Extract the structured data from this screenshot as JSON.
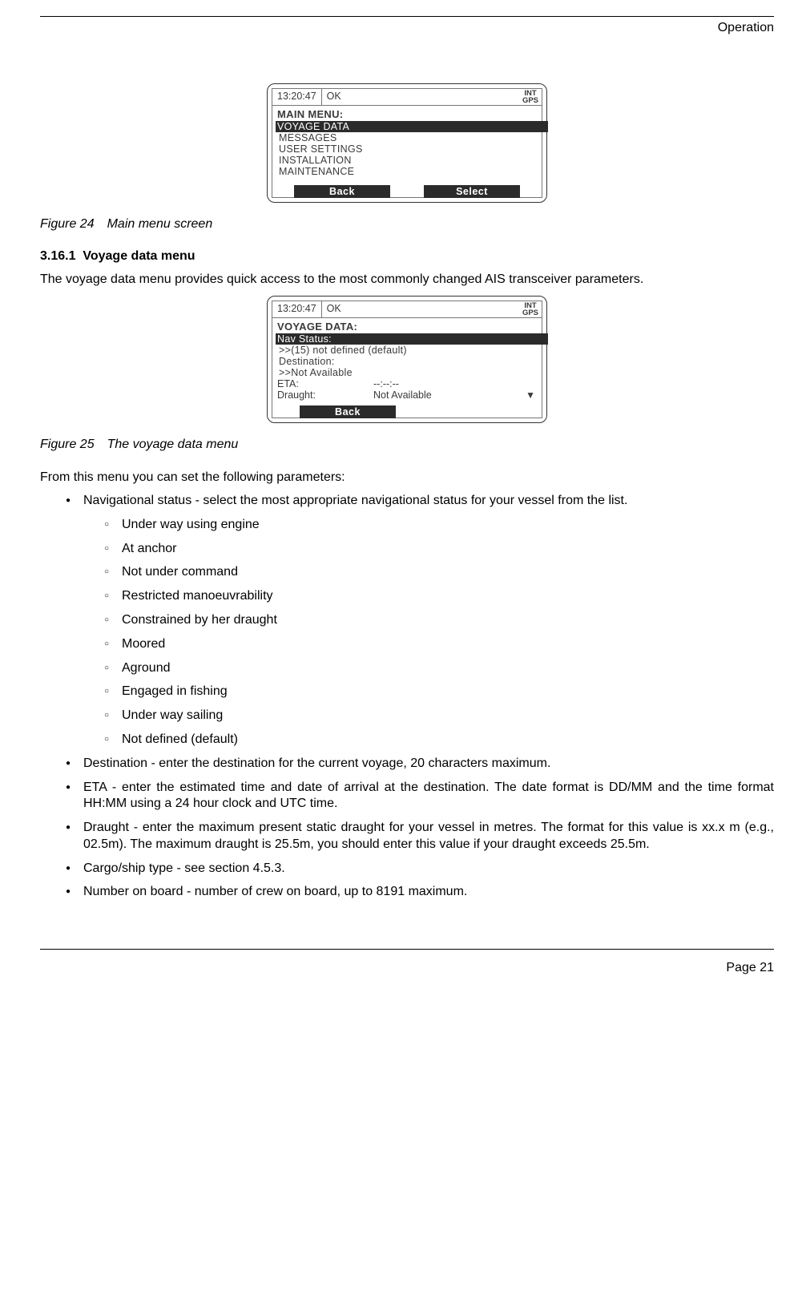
{
  "header": {
    "section": "Operation"
  },
  "screen1": {
    "time": "13:20:47",
    "status": "OK",
    "gps_l1": "INT",
    "gps_l2": "GPS",
    "title": "MAIN MENU:",
    "items": [
      "VOYAGE DATA",
      "MESSAGES",
      "USER SETTINGS",
      "INSTALLATION",
      "MAINTENANCE"
    ],
    "btn_back": "Back",
    "btn_select": "Select"
  },
  "fig24": {
    "num": "Figure 24",
    "caption": "Main menu screen"
  },
  "sec": {
    "num": "3.16.1",
    "title": "Voyage data menu"
  },
  "p1": "The voyage data menu provides quick access to the most commonly changed AIS transceiver parameters.",
  "screen2": {
    "time": "13:20:47",
    "status": "OK",
    "gps_l1": "INT",
    "gps_l2": "GPS",
    "title": "VOYAGE DATA:",
    "nav_label": "Nav Status:",
    "nav_value": ">>(15) not defined (default)",
    "dest_label": "Destination:",
    "dest_value": ">>Not Available",
    "eta_label": "ETA:",
    "eta_value": "--:--:--",
    "drt_label": "Draught:",
    "drt_value": "Not Available",
    "btn_back": "Back"
  },
  "fig25": {
    "num": "Figure 25",
    "caption": "The voyage data menu"
  },
  "p2": "From this menu you can set the following parameters:",
  "bullets": {
    "nav_intro": "Navigational status - select the most appropriate navigational status for your vessel from the list.",
    "nav_opts": [
      "Under way using engine",
      "At anchor",
      "Not under command",
      "Restricted manoeuvrability",
      "Constrained by her draught",
      "Moored",
      "Aground",
      "Engaged in fishing",
      "Under way sailing",
      "Not defined (default)"
    ],
    "dest": "Destination - enter the destination for the current voyage, 20 characters maximum.",
    "eta": "ETA - enter the estimated time and date of arrival at the destination. The date format is DD/MM and the time format HH:MM using a 24 hour clock and UTC time.",
    "draught": "Draught - enter the maximum present static draught for your vessel in metres. The format for this value is xx.x m (e.g., 02.5m). The maximum draught is 25.5m, you should enter this value if your draught exceeds 25.5m.",
    "cargo": "Cargo/ship type - see section 4.5.3.",
    "nob": "Number on board - number of crew on board, up to 8191 maximum."
  },
  "footer": {
    "page": "Page 21"
  }
}
